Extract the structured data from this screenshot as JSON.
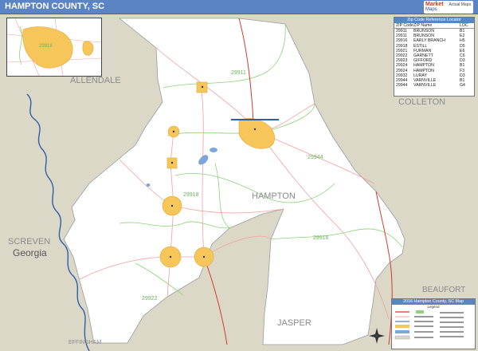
{
  "header": {
    "title": "HAMPTON COUNTY, SC"
  },
  "brand": {
    "logo_line1": "Market",
    "logo_line2": "Maps",
    "sub": "Actual Maps"
  },
  "map_labels": {
    "allendale": "ALLENDALE",
    "colleton": "COLLETON",
    "hampton": "HAMPTON",
    "screven": "SCREVEN",
    "georgia": "Georgia",
    "jasper": "JASPER",
    "beaufort": "BEAUFORT",
    "effingham": "EFFINGHAM",
    "zip_29911": "29911",
    "zip_29918": "29918",
    "zip_29944": "29944",
    "zip_29916": "29916",
    "zip_29922": "29922",
    "inset_zip": "29918"
  },
  "zip_table": {
    "title": "Zip Code Reference Locator",
    "columns": [
      "ZIP Code",
      "ZIP Name",
      "LOC"
    ],
    "rows": [
      [
        "29911",
        "BRUNSON",
        "B1"
      ],
      [
        "29911",
        "BRUNSON",
        "E2"
      ],
      [
        "29916",
        "EARLY BRANCH",
        "H5"
      ],
      [
        "29918",
        "ESTILL",
        "D5"
      ],
      [
        "29921",
        "FURMAN",
        "E6"
      ],
      [
        "29922",
        "GARNETT",
        "C6"
      ],
      [
        "29923",
        "GIFFORD",
        "D3"
      ],
      [
        "29924",
        "HAMPTON",
        "B1"
      ],
      [
        "29924",
        "HAMPTON",
        "F3"
      ],
      [
        "29932",
        "LURAY",
        "D3"
      ],
      [
        "29944",
        "VARNVILLE",
        "B1"
      ],
      [
        "29944",
        "VARNVILLE",
        "G4"
      ]
    ]
  },
  "legend": {
    "title": "2016 Hampton County, SC Map",
    "subtitle": "Legend"
  },
  "colors": {
    "outside": "#dcd8c8",
    "county": "#ffffff",
    "urban": "#f6c65a",
    "water": "#7fa6d6",
    "river": "#2d5fa8",
    "zip_boundary": "#8bd47a",
    "interstate": "#d23a2f",
    "road": "#f0a0a0",
    "header": "#5b84c4"
  }
}
